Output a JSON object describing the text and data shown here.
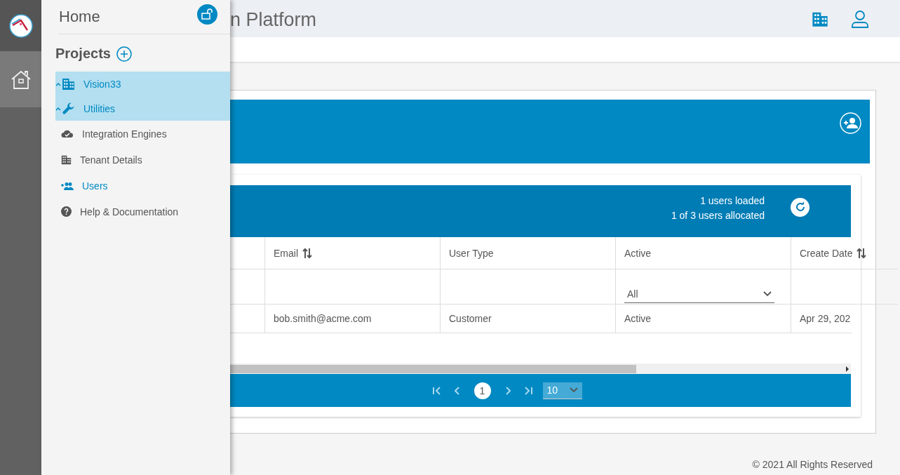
{
  "rail": {
    "home": {
      "selected": true
    }
  },
  "drawer": {
    "title": "Home",
    "projects_heading": "Projects",
    "tree": [
      {
        "label": "Vision33",
        "expanded": true,
        "selected": true,
        "children": [
          {
            "label": "Utilities",
            "expanded": true,
            "selected": true,
            "children": [
              {
                "label": "Integration Engines",
                "selected": false,
                "kind": "cloud"
              },
              {
                "label": "Tenant Details",
                "selected": false,
                "kind": "building"
              },
              {
                "label": "Users",
                "selected": true,
                "kind": "users"
              },
              {
                "label": "Help & Documentation",
                "selected": false,
                "kind": "help"
              }
            ]
          }
        ]
      }
    ]
  },
  "header": {
    "title": "n Platform"
  },
  "users_panel": {
    "summary": [
      "1 users loaded",
      "1 of 3 users allocated"
    ],
    "table": {
      "columns": [
        {
          "label": "Email",
          "sortable": true
        },
        {
          "label": "User Type",
          "sortable": false
        },
        {
          "label": "Active",
          "sortable": false,
          "filter": "All"
        },
        {
          "label": "Create Date",
          "sortable": true
        }
      ],
      "rows": [
        [
          "bob.smith@acme.com",
          "Customer",
          "Active",
          "Apr 29, 202"
        ]
      ]
    },
    "pagination": {
      "pages": [
        {
          "label": "1",
          "selected": true
        }
      ],
      "page_size": "10"
    }
  },
  "footer": "© 2021 All Rights Reserved"
}
